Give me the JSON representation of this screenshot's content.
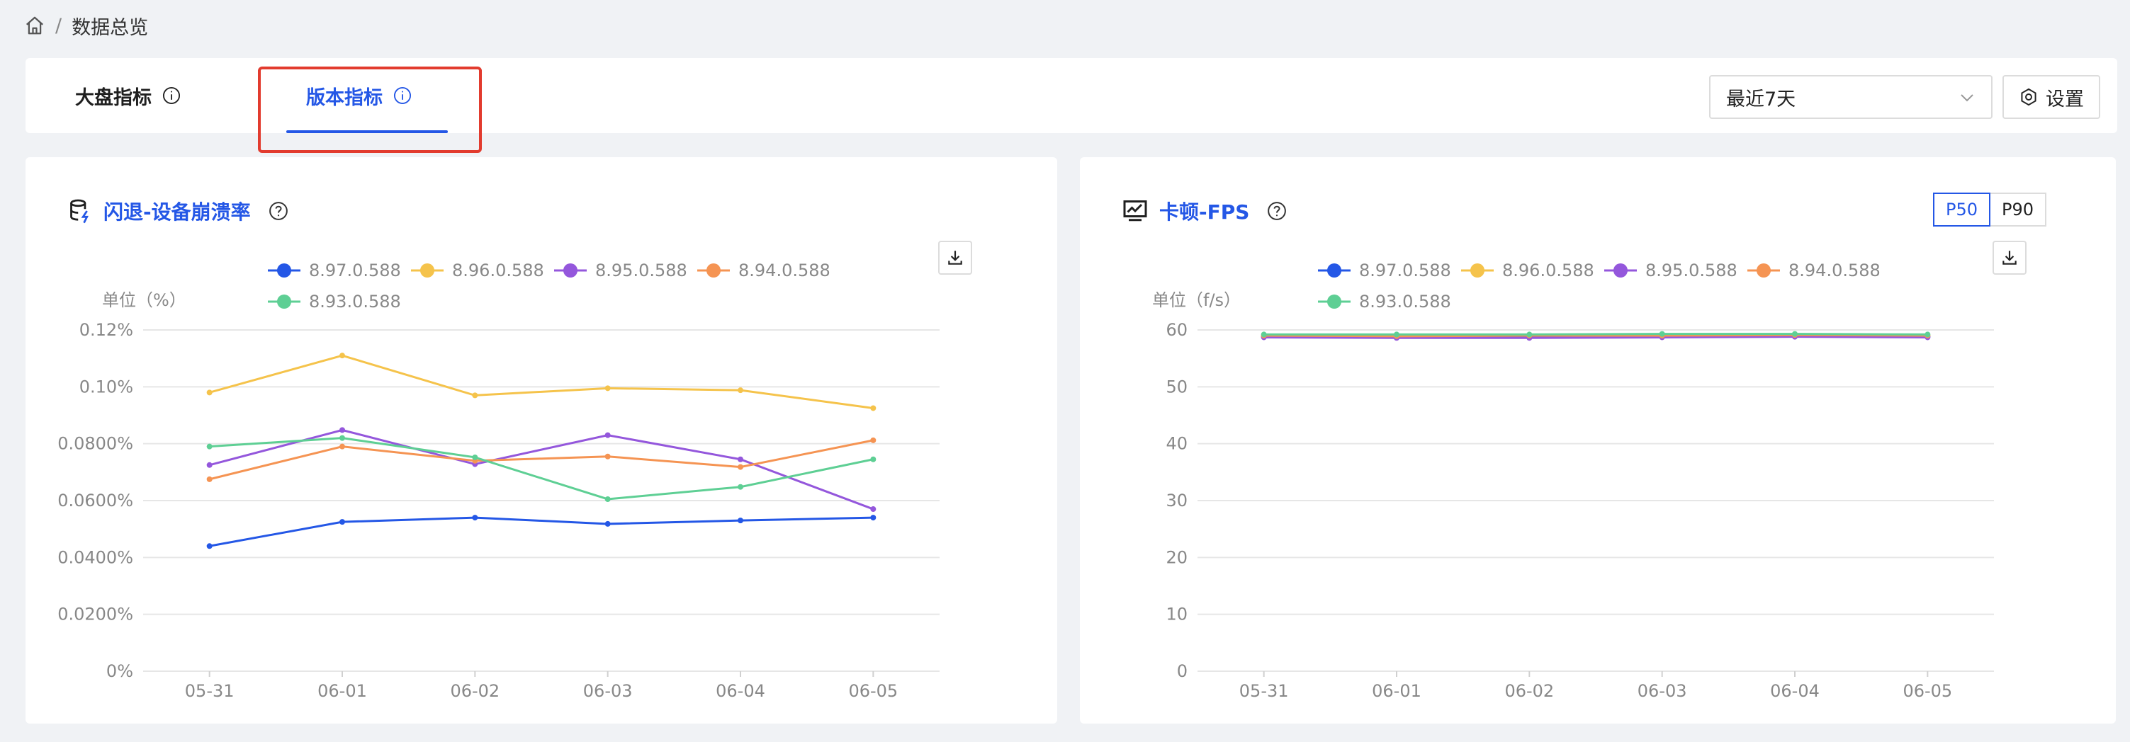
{
  "breadcrumb": {
    "home_icon": "home-icon",
    "separator": "/",
    "current": "数据总览"
  },
  "tabs": [
    {
      "label": "大盘指标",
      "active": false,
      "icon": "info-icon"
    },
    {
      "label": "版本指标",
      "active": true,
      "icon": "info-icon"
    }
  ],
  "toolbar": {
    "range_value": "最近7天",
    "settings_label": "设置",
    "settings_icon": "gear-icon"
  },
  "colors": {
    "accent": "#2457e6",
    "highlight": "#e23b2e"
  },
  "panels": {
    "crash": {
      "title": "闪退-设备崩溃率",
      "icon": "database-icon",
      "help_icon": "help-icon",
      "download_icon": "download-icon"
    },
    "fps": {
      "title": "卡顿-FPS",
      "icon": "monitor-chart-icon",
      "help_icon": "help-icon",
      "download_icon": "download-icon",
      "modes": [
        "P50",
        "P90"
      ],
      "active_mode": "P50"
    }
  },
  "chart_data": [
    {
      "type": "line",
      "title": "闪退-设备崩溃率",
      "unit_label": "单位（%）",
      "categories": [
        "05-31",
        "06-01",
        "06-02",
        "06-03",
        "06-04",
        "06-05"
      ],
      "y_ticks": [
        "0%",
        "0.0200%",
        "0.0400%",
        "0.0600%",
        "0.0800%",
        "0.10%",
        "0.12%"
      ],
      "ylim": [
        0,
        0.12
      ],
      "grid": true,
      "legend_position": "top",
      "series": [
        {
          "name": "8.97.0.588",
          "color": "#2457e6",
          "values": [
            0.044,
            0.0525,
            0.054,
            0.0518,
            0.053,
            0.054
          ]
        },
        {
          "name": "8.96.0.588",
          "color": "#f5c34b",
          "values": [
            0.098,
            0.111,
            0.097,
            0.0995,
            0.0988,
            0.0925
          ]
        },
        {
          "name": "8.95.0.588",
          "color": "#9457dc",
          "values": [
            0.0725,
            0.0848,
            0.0728,
            0.083,
            0.0745,
            0.057
          ]
        },
        {
          "name": "8.94.0.588",
          "color": "#f59453",
          "values": [
            0.0675,
            0.079,
            0.074,
            0.0755,
            0.0718,
            0.0812
          ]
        },
        {
          "name": "8.93.0.588",
          "color": "#5ecf94",
          "values": [
            0.079,
            0.082,
            0.0752,
            0.0605,
            0.0648,
            0.0745
          ]
        }
      ]
    },
    {
      "type": "line",
      "title": "卡顿-FPS",
      "unit_label": "单位（f/s）",
      "categories": [
        "05-31",
        "06-01",
        "06-02",
        "06-03",
        "06-04",
        "06-05"
      ],
      "y_ticks": [
        "0",
        "10",
        "20",
        "30",
        "40",
        "50",
        "60"
      ],
      "ylim": [
        0,
        60
      ],
      "grid": true,
      "legend_position": "top",
      "series": [
        {
          "name": "8.97.0.588",
          "color": "#2457e6",
          "values": [
            58.8,
            58.7,
            58.7,
            58.8,
            58.9,
            58.8
          ]
        },
        {
          "name": "8.96.0.588",
          "color": "#f5c34b",
          "values": [
            59.0,
            59.0,
            59.0,
            59.1,
            59.1,
            59.0
          ]
        },
        {
          "name": "8.95.0.588",
          "color": "#9457dc",
          "values": [
            58.7,
            58.6,
            58.6,
            58.7,
            58.8,
            58.7
          ]
        },
        {
          "name": "8.94.0.588",
          "color": "#f59453",
          "values": [
            59.0,
            58.9,
            59.0,
            59.0,
            59.1,
            59.0
          ]
        },
        {
          "name": "8.93.0.588",
          "color": "#5ecf94",
          "values": [
            59.2,
            59.2,
            59.2,
            59.3,
            59.3,
            59.2
          ]
        }
      ]
    }
  ]
}
